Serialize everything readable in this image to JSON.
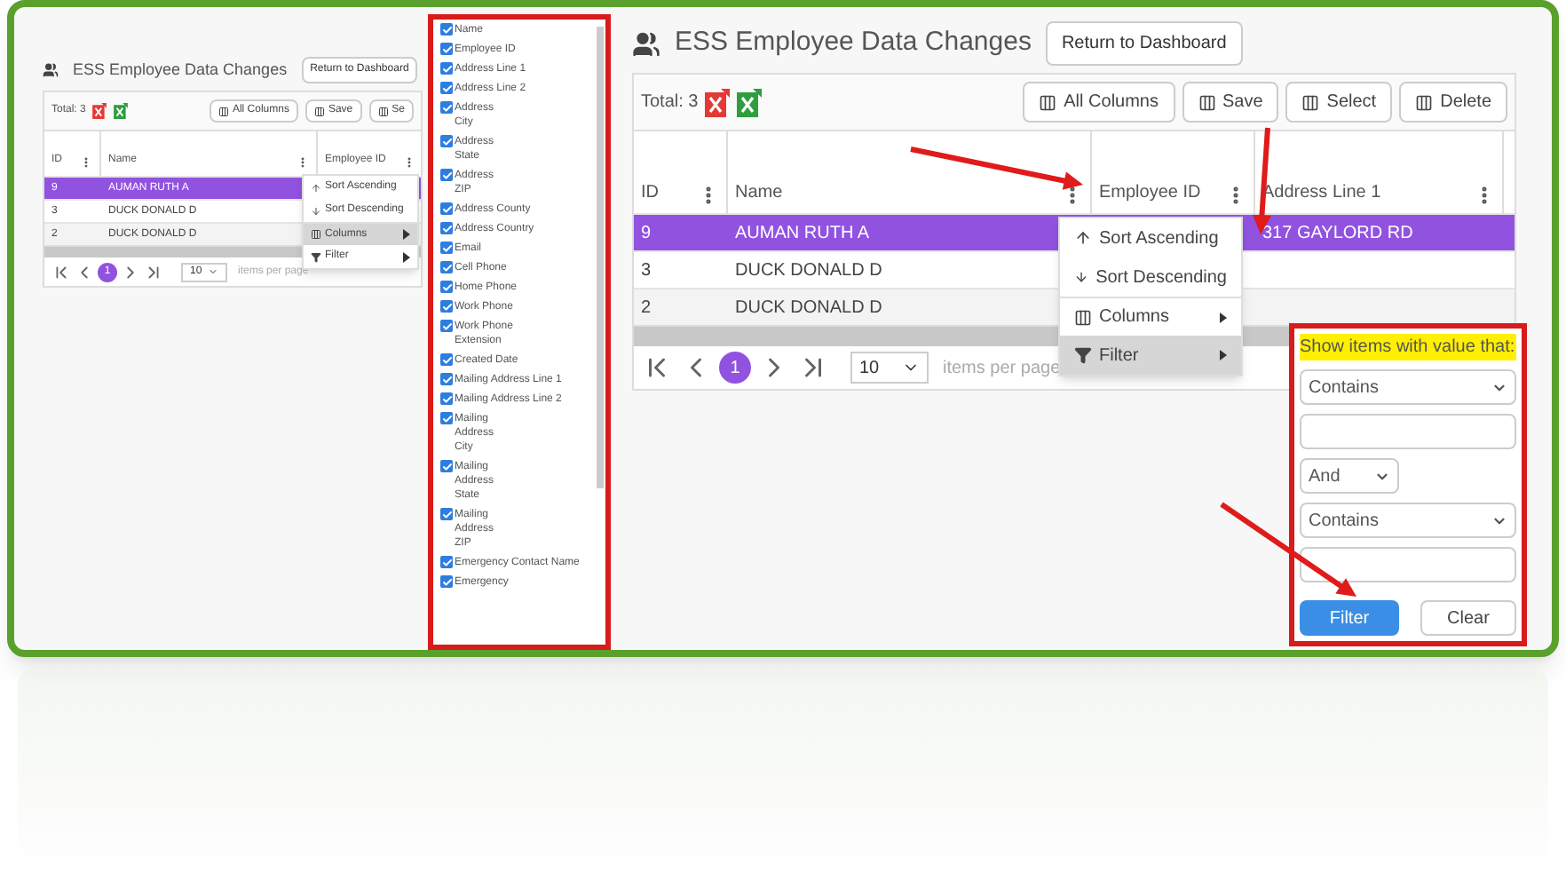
{
  "small_view": {
    "title": "ESS Employee Data Changes",
    "return_button": "Return to Dashboard",
    "total": "Total: 3",
    "toolbar_buttons": [
      "All Columns",
      "Save",
      "Se"
    ],
    "columns": [
      "ID",
      "Name",
      "Employee ID"
    ],
    "rows": [
      {
        "id": "9",
        "name": "AUMAN RUTH A",
        "selected": true
      },
      {
        "id": "3",
        "name": "DUCK DONALD D",
        "selected": false
      },
      {
        "id": "2",
        "name": "DUCK DONALD D",
        "selected": false
      }
    ],
    "menu": [
      {
        "kind": "sort-asc",
        "label": "Sort Ascending",
        "selected": false
      },
      {
        "kind": "sort-desc",
        "label": "Sort Descending",
        "selected": false
      },
      {
        "kind": "columns",
        "label": "Columns",
        "selected": true
      },
      {
        "kind": "filter",
        "label": "Filter",
        "selected": false
      }
    ],
    "pager": {
      "page": "1",
      "page_size": "10",
      "caption": "items per page"
    }
  },
  "column_chooser": {
    "items": [
      {
        "label": "Name",
        "checked": true
      },
      {
        "label": "Employee ID",
        "checked": true
      },
      {
        "label": "Address Line 1",
        "checked": true
      },
      {
        "label": "Address Line 2",
        "checked": true
      },
      {
        "label": "Address\nCity",
        "checked": true
      },
      {
        "label": "Address\nState",
        "checked": true
      },
      {
        "label": "Address\nZIP",
        "checked": true
      },
      {
        "label": "Address County",
        "checked": true
      },
      {
        "label": "Address Country",
        "checked": true
      },
      {
        "label": "Email",
        "checked": true
      },
      {
        "label": "Cell Phone",
        "checked": true
      },
      {
        "label": "Home Phone",
        "checked": true
      },
      {
        "label": "Work Phone",
        "checked": true
      },
      {
        "label": "Work Phone\nExtension",
        "checked": true
      },
      {
        "label": "Created Date",
        "checked": true
      },
      {
        "label": "Mailing Address Line 1",
        "checked": true
      },
      {
        "label": "Mailing Address Line 2",
        "checked": true
      },
      {
        "label": "Mailing\nAddress\nCity",
        "checked": true
      },
      {
        "label": "Mailing\nAddress\nState",
        "checked": true
      },
      {
        "label": "Mailing\nAddress\nZIP",
        "checked": true
      },
      {
        "label": "Emergency Contact Name",
        "checked": true
      },
      {
        "label": "Emergency",
        "checked": true
      }
    ]
  },
  "main_view": {
    "title": "ESS Employee Data Changes",
    "return_button": "Return to Dashboard",
    "total": "Total: 3",
    "toolbar_buttons": [
      "All Columns",
      "Save",
      "Select",
      "Delete"
    ],
    "columns": [
      "ID",
      "Name",
      "Employee ID",
      "Address Line 1"
    ],
    "rows": [
      {
        "id": "9",
        "name": "AUMAN RUTH A",
        "address": "317 GAYLORD RD",
        "selected": true
      },
      {
        "id": "3",
        "name": "DUCK DONALD D",
        "selected": false
      },
      {
        "id": "2",
        "name": "DUCK DONALD D",
        "selected": false
      }
    ],
    "menu": [
      {
        "kind": "sort-asc",
        "label": "Sort Ascending",
        "selected": false
      },
      {
        "kind": "sort-desc",
        "label": "Sort Descending",
        "selected": false
      },
      {
        "kind": "columns",
        "label": "Columns",
        "selected": false
      },
      {
        "kind": "filter",
        "label": "Filter",
        "selected": true
      }
    ],
    "pager": {
      "page": "1",
      "page_size": "10",
      "caption": "items per page"
    },
    "filter": {
      "heading": "Show items with value that:",
      "operator_1": "Contains",
      "logic": "And",
      "operator_2": "Contains",
      "apply_button": "Filter",
      "clear_button": "Clear"
    }
  }
}
